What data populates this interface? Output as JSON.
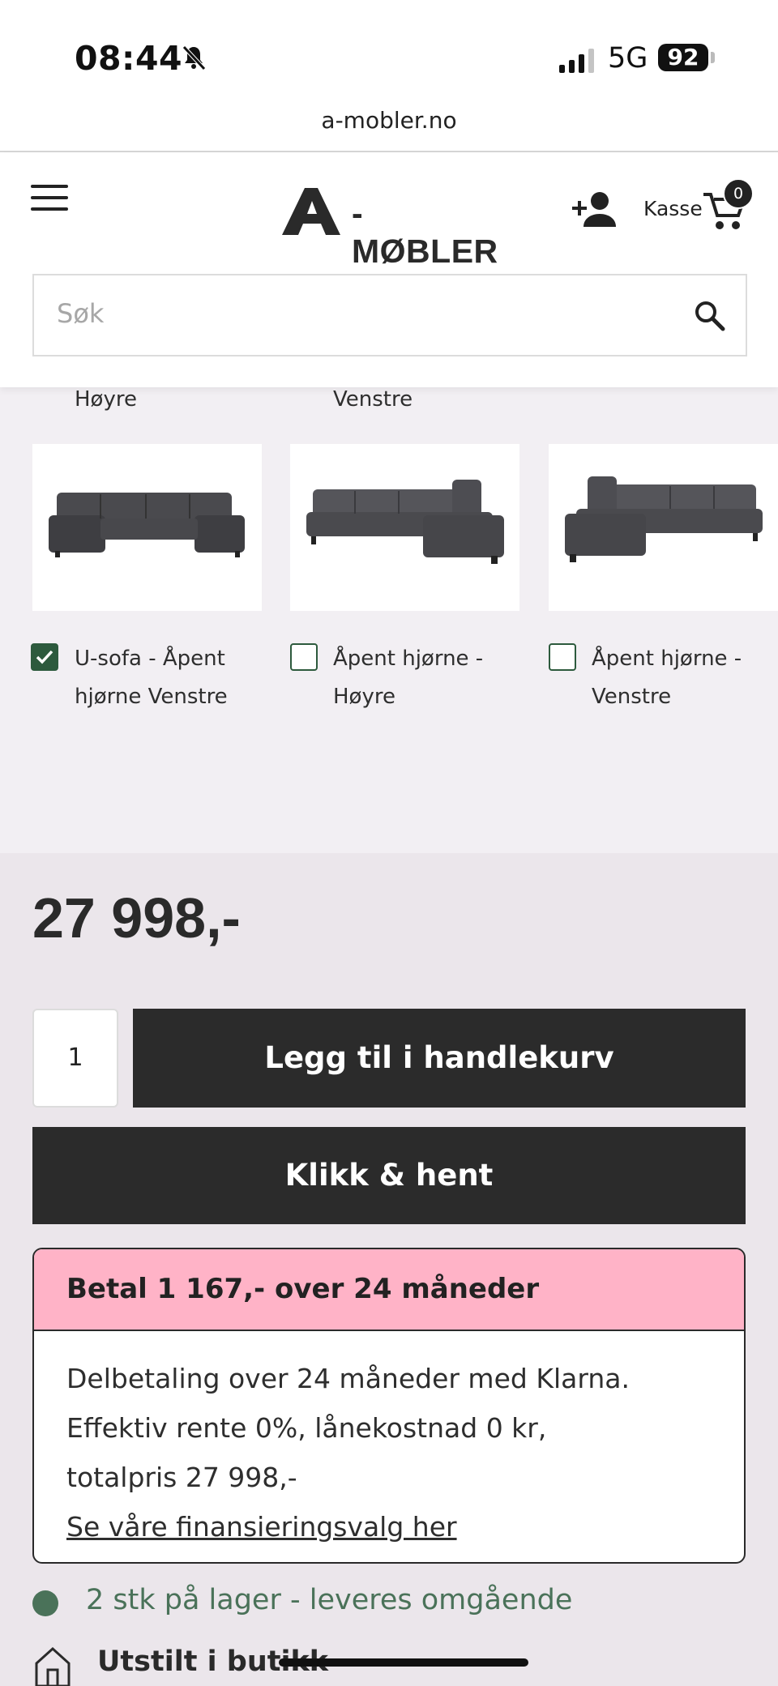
{
  "status_bar": {
    "time": "08:44",
    "network": "5G",
    "battery": "92"
  },
  "browser": {
    "url": "a-mobler.no"
  },
  "header": {
    "logo_text": "-MØBLER",
    "cart_label": "Kasse",
    "cart_count": "0"
  },
  "search": {
    "placeholder": "Søk"
  },
  "variants": {
    "previous_row_labels": [
      "Høyre",
      "Venstre"
    ],
    "items": [
      {
        "label": "U-sofa - Åpent hjørne Venstre",
        "checked": true
      },
      {
        "label": "Åpent hjørne - Høyre",
        "checked": false
      },
      {
        "label": "Åpent hjørne - Venstre",
        "checked": false
      }
    ]
  },
  "product": {
    "price": "27 998,-",
    "quantity": "1",
    "add_to_cart_label": "Legg til i handlekurv",
    "click_collect_label": "Klikk & hent"
  },
  "financing": {
    "headline": "Betal 1 167,- over 24 måneder",
    "line1": "Delbetaling over 24 måneder med Klarna.",
    "line2": "Effektiv rente 0%, lånekostnad 0 kr,",
    "line3": "totalpris 27 998,-",
    "link": "Se våre finansieringsvalg her",
    "accent_color": "#ffb3c7"
  },
  "availability": {
    "stock_text": "2 stk på lager - leveres omgående",
    "store_text": "Utstilt i butikk",
    "stock_color": "#4a7259"
  }
}
